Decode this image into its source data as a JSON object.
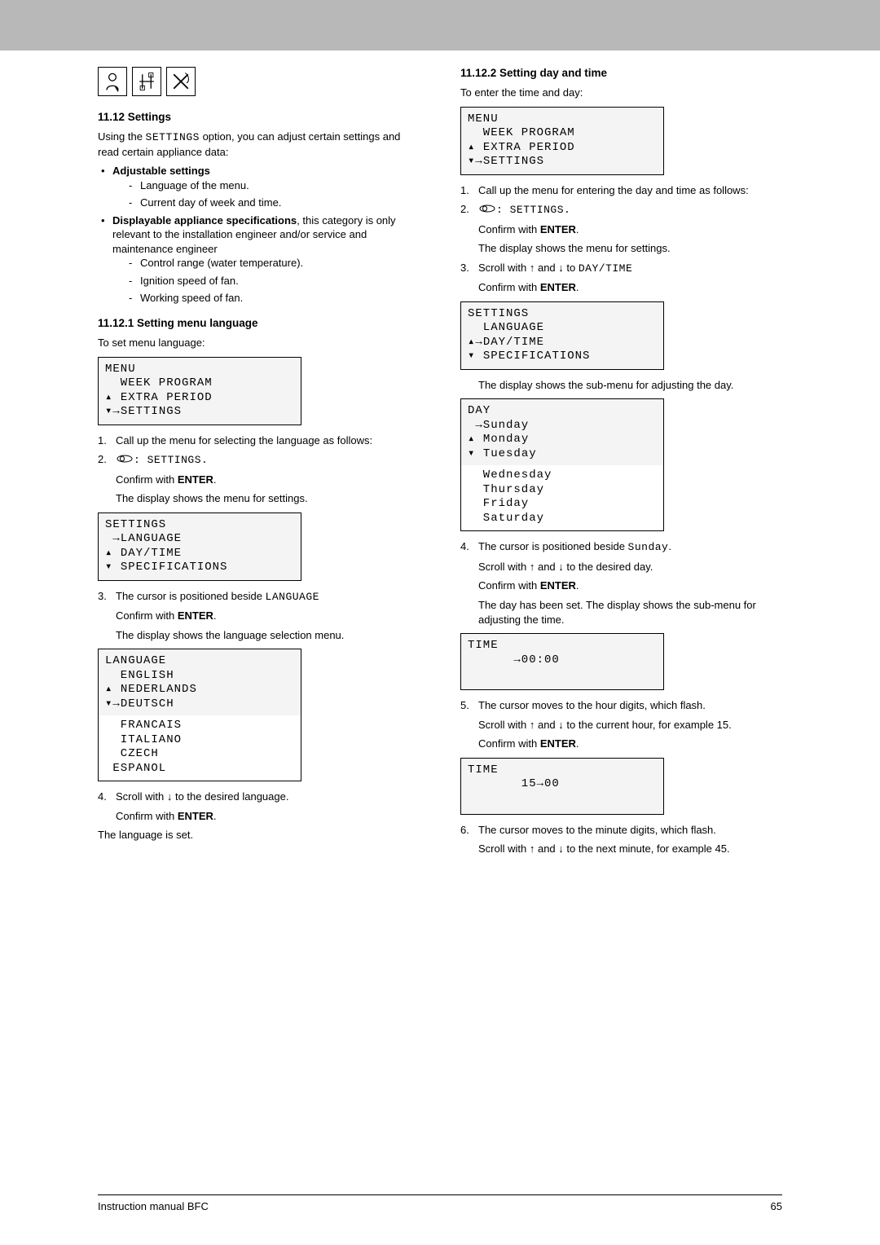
{
  "section": {
    "heading": "11.12 Settings",
    "intro": "Using the SETTINGS option, you can adjust certain settings and read certain appliance data:",
    "bullet1_label": "Adjustable settings",
    "bullet1_items": [
      "Language of the menu.",
      "Current day of week and time."
    ],
    "bullet2_label": "Displayable appliance specifications",
    "bullet2_cont": ", this category is only relevant to the installation engineer and/or service and maintenance engineer",
    "bullet2_items": [
      "Control range (water temperature).",
      "Ignition speed of fan.",
      "Working speed of fan."
    ]
  },
  "sub1": {
    "heading": "11.12.1  Setting menu language",
    "intro": "To set menu language:",
    "menu_box": "MENU\n  WEEK PROGRAM\n▴ EXTRA PERIOD\n▾→SETTINGS",
    "step1": "Call up the menu for selecting the language as follows:",
    "step2_pre": ": SETTINGS.",
    "step2_confirm": "Confirm with ENTER.",
    "step2_display": "The display shows the menu for settings.",
    "settings_box": "SETTINGS\n →LANGUAGE\n▴ DAY/TIME\n▾ SPECIFICATIONS",
    "step3_pre": "The cursor is positioned beside LANGUAGE",
    "step3_confirm": "Confirm with ENTER.",
    "step3_display": "The display shows the language selection menu.",
    "lang_box": "LANGUAGE\n  ENGLISH\n▴ NEDERLANDS\n▾→DEUTSCH",
    "lang_box_ext": "  FRANCAIS\n  ITALIANO\n  CZECH\n ESPANOL",
    "step4": "Scroll with ✦ to the desired language.",
    "step4_confirm": "Confirm with ENTER.",
    "closing": "The language is set."
  },
  "sub2": {
    "heading": "11.12.2  Setting day and time",
    "intro": "To enter the time and day:",
    "menu_box": "MENU\n  WEEK PROGRAM\n▴ EXTRA PERIOD\n▾→SETTINGS",
    "step1": "Call up the menu for entering the day and time as follows:",
    "step2_pre": ": SETTINGS.",
    "step2_confirm": "Confirm with ENTER.",
    "step2_display": "The display shows the menu for settings.",
    "step3_pre": "Scroll with ✦ and ✦ to DAY/TIME",
    "step3_confirm": "Confirm with ENTER.",
    "settings_box": "SETTINGS\n  LANGUAGE\n▴→DAY/TIME\n▾ SPECIFICATIONS",
    "step3_display": "The display shows the sub-menu for adjusting the day.",
    "day_box": "DAY\n →Sunday\n▴ Monday\n▾ Tuesday",
    "day_box_ext": "  Wednesday\n  Thursday\n  Friday\n  Saturday",
    "step4_pre": "The cursor is positioned beside Sunday.",
    "step4_scroll": "Scroll with ✦ and ✦ to the desired day.",
    "step4_confirm": "Confirm with ENTER.",
    "step4_display": "The day has been set. The display shows the sub-menu for adjusting the time.",
    "time_box1": "TIME\n      →00:00",
    "step5_pre": "The cursor moves to the hour digits, which flash.",
    "step5_scroll": "Scroll with ✦ and ✦ to the current hour, for example 15.",
    "step5_confirm": "Confirm with ENTER.",
    "time_box2": "TIME\n       15→00",
    "step6_pre": "The cursor moves to the minute digits, which flash.",
    "step6_scroll": "Scroll with ✦ and ✦ to the next minute, for example 45."
  },
  "footer": {
    "left": "Instruction manual BFC",
    "right": "65"
  }
}
